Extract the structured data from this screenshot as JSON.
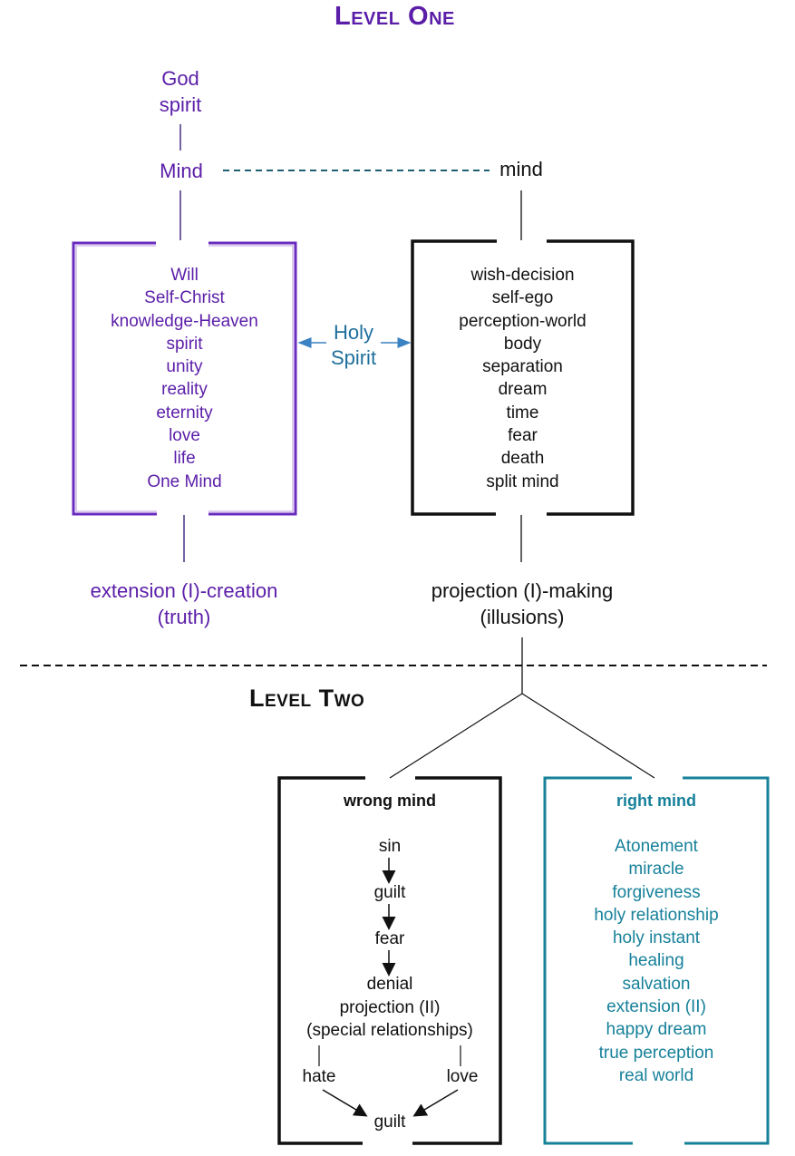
{
  "level_one": {
    "heading": "Level One",
    "god": "God",
    "spirit": "spirit",
    "Mind": "Mind",
    "mind": "mind",
    "holy_spirit_line1": "Holy",
    "holy_spirit_line2": "Spirit",
    "left_box": {
      "items": [
        "Will",
        "Self-Christ",
        "knowledge-Heaven",
        "spirit",
        "unity",
        "reality",
        "eternity",
        "love",
        "life",
        "One Mind"
      ]
    },
    "right_box": {
      "items": [
        "wish-decision",
        "self-ego",
        "perception-world",
        "body",
        "separation",
        "dream",
        "time",
        "fear",
        "death",
        "split mind"
      ]
    },
    "left_outcome_line1": "extension (I)-creation",
    "left_outcome_line2": "(truth)",
    "right_outcome_line1": "projection (I)-making",
    "right_outcome_line2": "(illusions)"
  },
  "level_two": {
    "heading": "Level Two",
    "wrong_mind": {
      "title": "wrong mind",
      "chain": [
        "sin",
        "guilt",
        "fear"
      ],
      "denial": "denial",
      "projection": "projection (II)",
      "special": "(special relationships)",
      "hate": "hate",
      "love": "love",
      "guilt_end": "guilt"
    },
    "right_mind": {
      "title": "right mind",
      "items": [
        "Atonement",
        "miracle",
        "forgiveness",
        "holy relationship",
        "holy instant",
        "healing",
        "salvation",
        "extension (II)",
        "happy dream",
        "true perception",
        "real world"
      ]
    }
  },
  "colors": {
    "purple": "#5b1ea8",
    "purple_border": "#6a2bbf",
    "black": "#111111",
    "teal": "#17819a",
    "blue_arrow": "#3b82c4",
    "dash_teal": "#1d5f73"
  }
}
